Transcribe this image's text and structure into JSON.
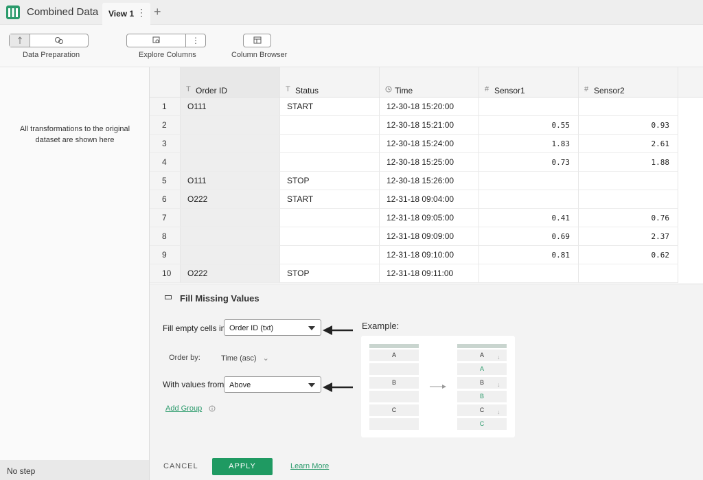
{
  "app": {
    "title": "Combined Data",
    "brand_color": "#2a9a6b"
  },
  "tabs": [
    {
      "label": "View 1",
      "menu_icon": "kebab-icon"
    }
  ],
  "add_tab_icon": "plus-icon",
  "toolbar": {
    "data_preparation": "Data Preparation",
    "explore_columns": "Explore Columns",
    "column_browser": "Column Browser"
  },
  "left_panel": {
    "message": "All transformations to the original dataset are shown here",
    "footer": "No step"
  },
  "grid": {
    "columns": [
      {
        "icon": "T",
        "label": "Order ID"
      },
      {
        "icon": "T",
        "label": "Status"
      },
      {
        "icon": "clock",
        "label": "Time"
      },
      {
        "icon": "#",
        "label": "Sensor1"
      },
      {
        "icon": "#",
        "label": "Sensor2"
      }
    ],
    "rows": [
      {
        "n": "1",
        "order": "O111",
        "status": "START",
        "time": "12-30-18 15:20:00",
        "s1": "",
        "s2": ""
      },
      {
        "n": "2",
        "order": "",
        "status": "",
        "time": "12-30-18 15:21:00",
        "s1": "0.55",
        "s2": "0.93"
      },
      {
        "n": "3",
        "order": "",
        "status": "",
        "time": "12-30-18 15:24:00",
        "s1": "1.83",
        "s2": "2.61"
      },
      {
        "n": "4",
        "order": "",
        "status": "",
        "time": "12-30-18 15:25:00",
        "s1": "0.73",
        "s2": "1.88"
      },
      {
        "n": "5",
        "order": "O111",
        "status": "STOP",
        "time": "12-30-18 15:26:00",
        "s1": "",
        "s2": ""
      },
      {
        "n": "6",
        "order": "O222",
        "status": "START",
        "time": "12-31-18 09:04:00",
        "s1": "",
        "s2": ""
      },
      {
        "n": "7",
        "order": "",
        "status": "",
        "time": "12-31-18 09:05:00",
        "s1": "0.41",
        "s2": "0.76"
      },
      {
        "n": "8",
        "order": "",
        "status": "",
        "time": "12-31-18 09:09:00",
        "s1": "0.69",
        "s2": "2.37"
      },
      {
        "n": "9",
        "order": "",
        "status": "",
        "time": "12-31-18 09:10:00",
        "s1": "0.81",
        "s2": "0.62"
      },
      {
        "n": "10",
        "order": "O222",
        "status": "STOP",
        "time": "12-31-18 09:11:00",
        "s1": "",
        "s2": ""
      }
    ]
  },
  "dialog": {
    "title": "Fill Missing Values",
    "fill_label": "Fill empty cells in:",
    "fill_value": "Order ID (txt)",
    "order_label": "Order by:",
    "order_value": "Time (asc)",
    "values_label": "With values from:",
    "values_value": "Above",
    "add_group": "Add Group",
    "example_title": "Example:",
    "example_before": [
      "A",
      "",
      "B",
      "",
      "C",
      ""
    ],
    "example_after": [
      "A",
      "A",
      "B",
      "B",
      "C",
      "C"
    ],
    "cancel": "CANCEL",
    "apply": "APPLY",
    "learn_more": "Learn More",
    "apply_color": "#1f9a62"
  }
}
